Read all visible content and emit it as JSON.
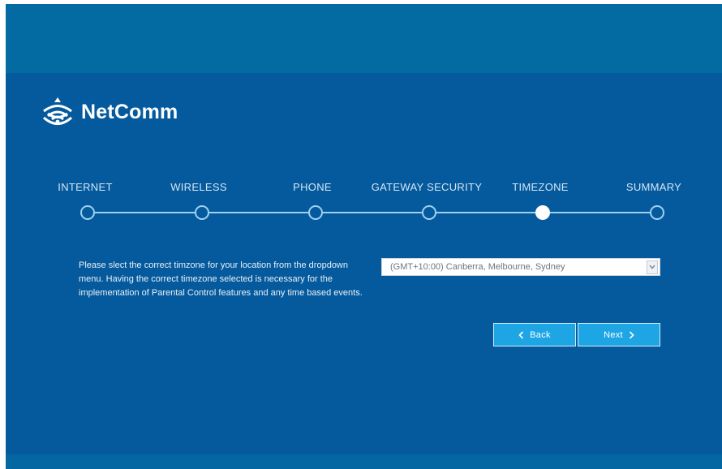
{
  "brand": {
    "name": "NetComm",
    "logo_icon": "wifi-signal-icon",
    "colors": {
      "panel": "#055a9d",
      "accent": "#1ea5e4",
      "track": "#9ed0f0"
    }
  },
  "wizard": {
    "steps": [
      {
        "label": "INTERNET",
        "active": false
      },
      {
        "label": "WIRELESS",
        "active": false
      },
      {
        "label": "PHONE",
        "active": false
      },
      {
        "label": "GATEWAY SECURITY",
        "active": false
      },
      {
        "label": "TIMEZONE",
        "active": true
      },
      {
        "label": "SUMMARY",
        "active": false
      }
    ]
  },
  "timezone": {
    "description": "Please slect the correct timzone for your location from the dropdown menu. Having the correct timezone selected is necessary for the implementation of Parental Control features and any time based events.",
    "selected": "(GMT+10:00) Canberra, Melbourne, Sydney"
  },
  "buttons": {
    "back_label": "Back",
    "back_icon": "chevron-left-icon",
    "next_label": "Next",
    "next_icon": "chevron-right-icon"
  }
}
